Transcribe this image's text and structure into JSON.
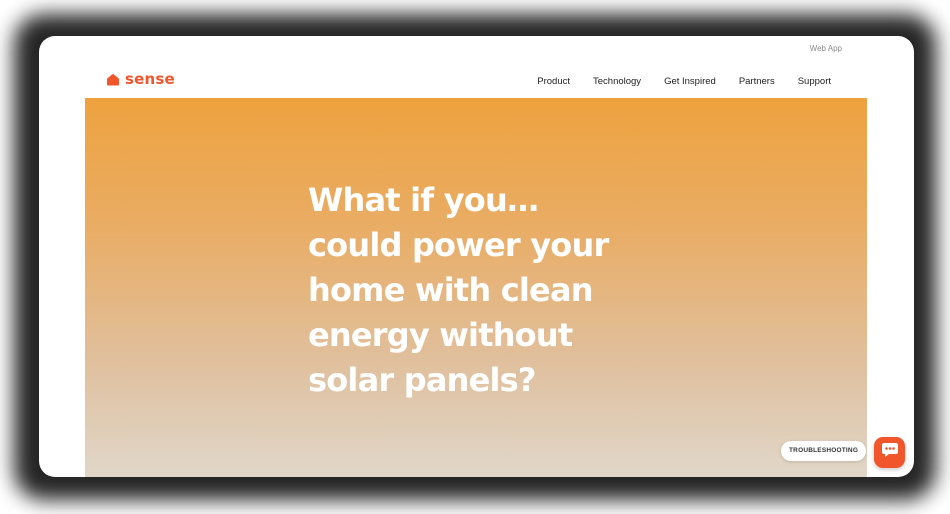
{
  "utility": {
    "web_app_label": "Web App"
  },
  "brand": {
    "name": "sense",
    "color": "#f0552c",
    "icon": "house-icon"
  },
  "nav": {
    "items": [
      {
        "label": "Product"
      },
      {
        "label": "Technology"
      },
      {
        "label": "Get Inspired"
      },
      {
        "label": "Partners"
      },
      {
        "label": "Support"
      }
    ]
  },
  "hero": {
    "headline_lines": [
      "What if you…",
      "could power your",
      "home with clean",
      "energy without",
      "solar panels?"
    ],
    "gradient_top": "#eea23e",
    "gradient_bottom": "#e0d7c9"
  },
  "widgets": {
    "troubleshooting_label": "TROUBLESHOOTING",
    "chat_icon": "chat-bubble-icon",
    "chat_color": "#f0552c"
  }
}
